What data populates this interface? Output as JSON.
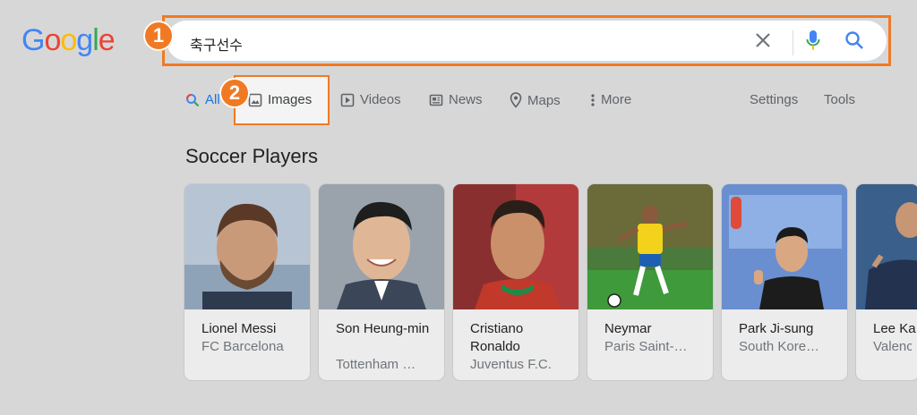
{
  "logo": {
    "letters": [
      "G",
      "o",
      "o",
      "g",
      "l",
      "e"
    ],
    "colors": [
      "#4285F4",
      "#EA4335",
      "#FBBC05",
      "#4285F4",
      "#34A853",
      "#EA4335"
    ]
  },
  "search": {
    "query": "축구선수"
  },
  "annotations": {
    "badge1": "1",
    "badge2": "2",
    "accent": "#f07a24"
  },
  "tabs": [
    {
      "label": "All",
      "icon": "search-icon"
    },
    {
      "label": "Images",
      "icon": "image-icon"
    },
    {
      "label": "Videos",
      "icon": "play-icon"
    },
    {
      "label": "News",
      "icon": "news-icon"
    },
    {
      "label": "Maps",
      "icon": "map-pin-icon"
    },
    {
      "label": "More",
      "icon": "more-vert-icon"
    }
  ],
  "tools": {
    "settings": "Settings",
    "tools": "Tools"
  },
  "section": {
    "title": "Soccer Players"
  },
  "cards": [
    {
      "name": "Lionel Messi",
      "sub": "FC Barcelona"
    },
    {
      "name": "Son Heung-min",
      "sub": "Tottenham …"
    },
    {
      "name": "Cristiano Ronaldo",
      "sub": "Juventus F.C."
    },
    {
      "name": "Neymar",
      "sub": "Paris Saint-…"
    },
    {
      "name": "Park Ji-sung",
      "sub": "South Kore…"
    },
    {
      "name": "Lee Ka",
      "sub": "Valenc"
    }
  ]
}
